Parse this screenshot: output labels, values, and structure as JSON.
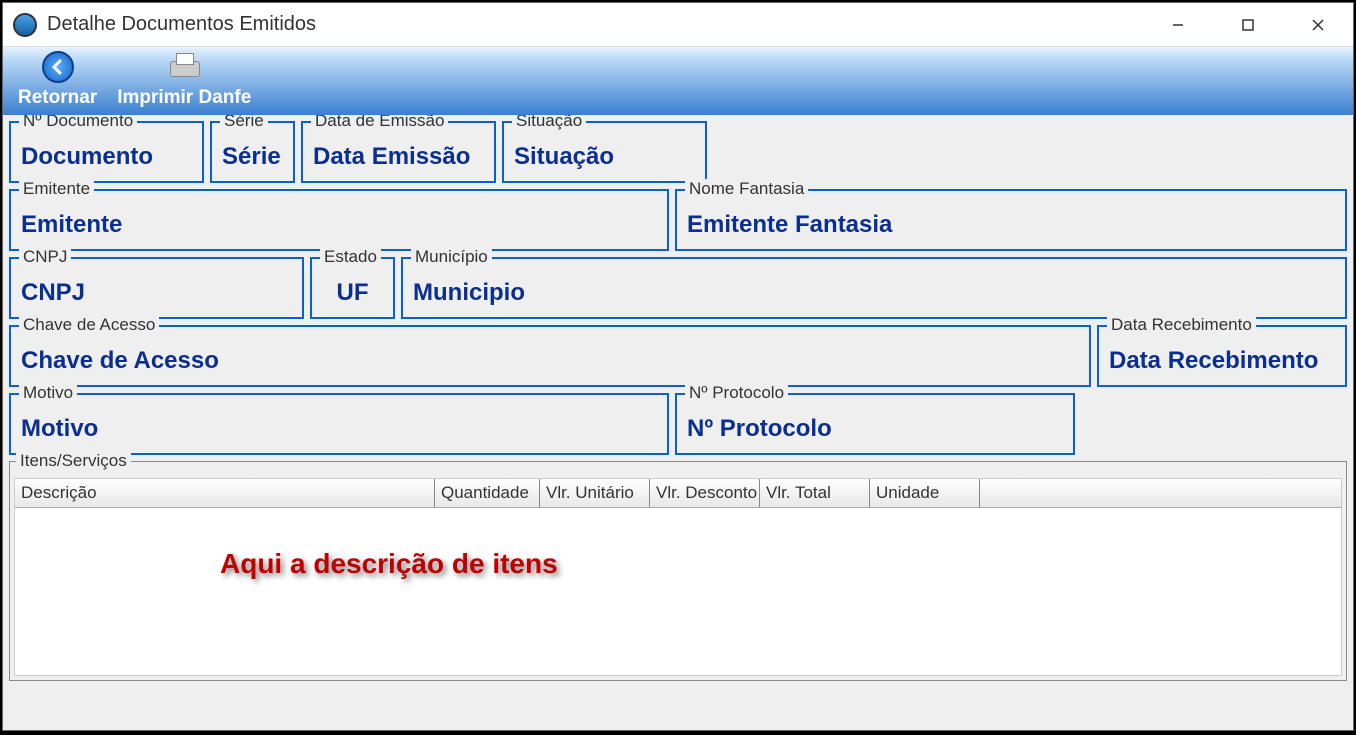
{
  "window": {
    "title": "Detalhe Documentos Emitidos"
  },
  "toolbar": {
    "back_label": "Retornar",
    "print_label": "Imprimir Danfe"
  },
  "fields": {
    "num_documento": {
      "label": "Nº Documento",
      "value": "Documento"
    },
    "serie": {
      "label": "Série",
      "value": "Série"
    },
    "data_emissao": {
      "label": "Data de Emissão",
      "value": "Data Emissão"
    },
    "situacao": {
      "label": "Situação",
      "value": "Situação"
    },
    "emitente": {
      "label": "Emitente",
      "value": "Emitente"
    },
    "nome_fantasia": {
      "label": "Nome Fantasia",
      "value": "Emitente Fantasia"
    },
    "cnpj": {
      "label": "CNPJ",
      "value": "CNPJ"
    },
    "estado": {
      "label": "Estado",
      "value": "UF"
    },
    "municipio": {
      "label": "Município",
      "value": "Municipio"
    },
    "chave_acesso": {
      "label": "Chave de Acesso",
      "value": "Chave de Acesso"
    },
    "data_recebimento": {
      "label": "Data Recebimento",
      "value": "Data Recebimento"
    },
    "motivo": {
      "label": "Motivo",
      "value": "Motivo"
    },
    "num_protocolo": {
      "label": "Nº Protocolo",
      "value": "Nº Protocolo"
    }
  },
  "itens": {
    "label": "Itens/Serviços",
    "columns": {
      "descricao": "Descrição",
      "quantidade": "Quantidade",
      "vlr_unitario": "Vlr. Unitário",
      "vlr_desconto": "Vlr. Desconto",
      "vlr_total": "Vlr. Total",
      "unidade": "Unidade"
    },
    "overlay": "Aqui a descrição de itens"
  }
}
